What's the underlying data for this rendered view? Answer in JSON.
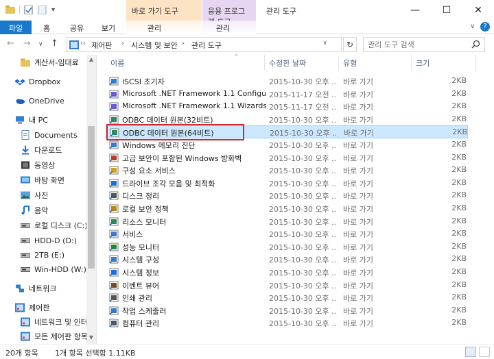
{
  "titlebar": {
    "context_tab_shortcut": "바로 가기 도구",
    "context_tab_app": "응용 프로그램 도구",
    "title": "관리 도구",
    "minimize": "—",
    "maximize": "☐",
    "close": "✕"
  },
  "ribbon": {
    "tabs": [
      "파일",
      "홈",
      "공유",
      "보기",
      "관리",
      "관리"
    ]
  },
  "address": {
    "root_glyph": "‹‹",
    "segments": [
      "제어판",
      "시스템 및 보안",
      "관리 도구"
    ],
    "separator": "›",
    "dropdown": "∨",
    "refresh": "↻",
    "search_placeholder": "관리 도구 검색"
  },
  "nav": {
    "items": [
      {
        "label": "계산서-임대료",
        "icon": "folder-icon"
      },
      {
        "label": "Dropbox",
        "icon": "dropbox-icon"
      },
      {
        "label": "OneDrive",
        "icon": "onedrive-icon"
      },
      {
        "label": "내 PC",
        "icon": "pc-icon"
      },
      {
        "label": "Documents",
        "icon": "documents-icon"
      },
      {
        "label": "다운로드",
        "icon": "download-icon"
      },
      {
        "label": "동영상",
        "icon": "video-icon"
      },
      {
        "label": "바탕 화면",
        "icon": "desktop-icon"
      },
      {
        "label": "사진",
        "icon": "pictures-icon"
      },
      {
        "label": "음악",
        "icon": "music-icon"
      },
      {
        "label": "로컬 디스크 (C:)",
        "icon": "disk-icon"
      },
      {
        "label": "HDD-D (D:)",
        "icon": "disk-icon"
      },
      {
        "label": "2TB (E:)",
        "icon": "disk-icon"
      },
      {
        "label": "Win-HDD (W:)",
        "icon": "disk-icon"
      },
      {
        "label": "네트워크",
        "icon": "network-icon"
      },
      {
        "label": "제어판",
        "icon": "control-panel-icon"
      },
      {
        "label": "네트워크 및 인터",
        "icon": "control-panel-icon"
      },
      {
        "label": "모든 제어판 항목",
        "icon": "control-panel-icon"
      }
    ]
  },
  "list": {
    "columns": {
      "name": "이름",
      "date": "수정한 날짜",
      "type": "유형",
      "size": "크기"
    },
    "files": [
      {
        "name": "iSCSI 초기자",
        "date": "2015-10-30 오후 ...",
        "type": "바로 가기",
        "size": "2KB",
        "icon": "iscsi-icon"
      },
      {
        "name": "Microsoft .NET Framework 1.1 Configur...",
        "date": "2015-11-17 오전 ...",
        "type": "바로 가기",
        "size": "2KB",
        "icon": "dotnet-config-icon"
      },
      {
        "name": "Microsoft .NET Framework 1.1 Wizards",
        "date": "2015-11-17 오전 ...",
        "type": "바로 가기",
        "size": "2KB",
        "icon": "dotnet-wizard-icon"
      },
      {
        "name": "ODBC 데이터 원본(32비트)",
        "date": "2015-10-30 오후 ...",
        "type": "바로 가기",
        "size": "2KB",
        "icon": "odbc-icon"
      },
      {
        "name": "ODBC 데이터 원본(64비트)",
        "date": "2015-10-30 오후 ...",
        "type": "바로 가기",
        "size": "2KB",
        "icon": "odbc-icon"
      },
      {
        "name": "Windows 메모리 진단",
        "date": "2015-10-30 오후 ...",
        "type": "바로 가기",
        "size": "2KB",
        "icon": "memory-diagnostic-icon"
      },
      {
        "name": "고급 보안이 포함된 Windows 방화벽",
        "date": "2015-10-30 오후 ...",
        "type": "바로 가기",
        "size": "2KB",
        "icon": "firewall-icon"
      },
      {
        "name": "구성 요소 서비스",
        "date": "2015-10-30 오후 ...",
        "type": "바로 가기",
        "size": "2KB",
        "icon": "component-services-icon"
      },
      {
        "name": "드라이브 조각 모음 및 최적화",
        "date": "2015-10-30 오후 ...",
        "type": "바로 가기",
        "size": "2KB",
        "icon": "defrag-icon"
      },
      {
        "name": "디스크 정리",
        "date": "2015-10-30 오후 ...",
        "type": "바로 가기",
        "size": "2KB",
        "icon": "disk-cleanup-icon"
      },
      {
        "name": "로컬 보안 정책",
        "date": "2015-10-30 오후 ...",
        "type": "바로 가기",
        "size": "2KB",
        "icon": "security-policy-icon"
      },
      {
        "name": "리소스 모니터",
        "date": "2015-10-30 오후 ...",
        "type": "바로 가기",
        "size": "2KB",
        "icon": "resource-monitor-icon"
      },
      {
        "name": "서비스",
        "date": "2015-10-30 오후 ...",
        "type": "바로 가기",
        "size": "2KB",
        "icon": "services-icon"
      },
      {
        "name": "성능 모니터",
        "date": "2015-10-30 오후 ...",
        "type": "바로 가기",
        "size": "2KB",
        "icon": "performance-monitor-icon"
      },
      {
        "name": "시스템 구성",
        "date": "2015-10-30 오후 ...",
        "type": "바로 가기",
        "size": "2KB",
        "icon": "system-config-icon"
      },
      {
        "name": "시스템 정보",
        "date": "2015-10-30 오후 ...",
        "type": "바로 가기",
        "size": "2KB",
        "icon": "system-info-icon"
      },
      {
        "name": "이벤트 뷰어",
        "date": "2015-10-30 오후 ...",
        "type": "바로 가기",
        "size": "2KB",
        "icon": "event-viewer-icon"
      },
      {
        "name": "인쇄 관리",
        "date": "2015-10-30 오후 ...",
        "type": "바로 가기",
        "size": "2KB",
        "icon": "print-management-icon"
      },
      {
        "name": "작업 스케줄러",
        "date": "2015-10-30 오후 ...",
        "type": "바로 가기",
        "size": "2KB",
        "icon": "task-scheduler-icon"
      },
      {
        "name": "컴퓨터 관리",
        "date": "2015-10-30 오후 ...",
        "type": "바로 가기",
        "size": "2KB",
        "icon": "computer-management-icon"
      }
    ]
  },
  "status": {
    "count": "20개 항목",
    "selection": "1개 항목 선택함 1.11KB"
  },
  "colors": {
    "accent": "#1979ca",
    "selection_bg": "#cce8ff",
    "highlight_border": "#d7262c"
  }
}
